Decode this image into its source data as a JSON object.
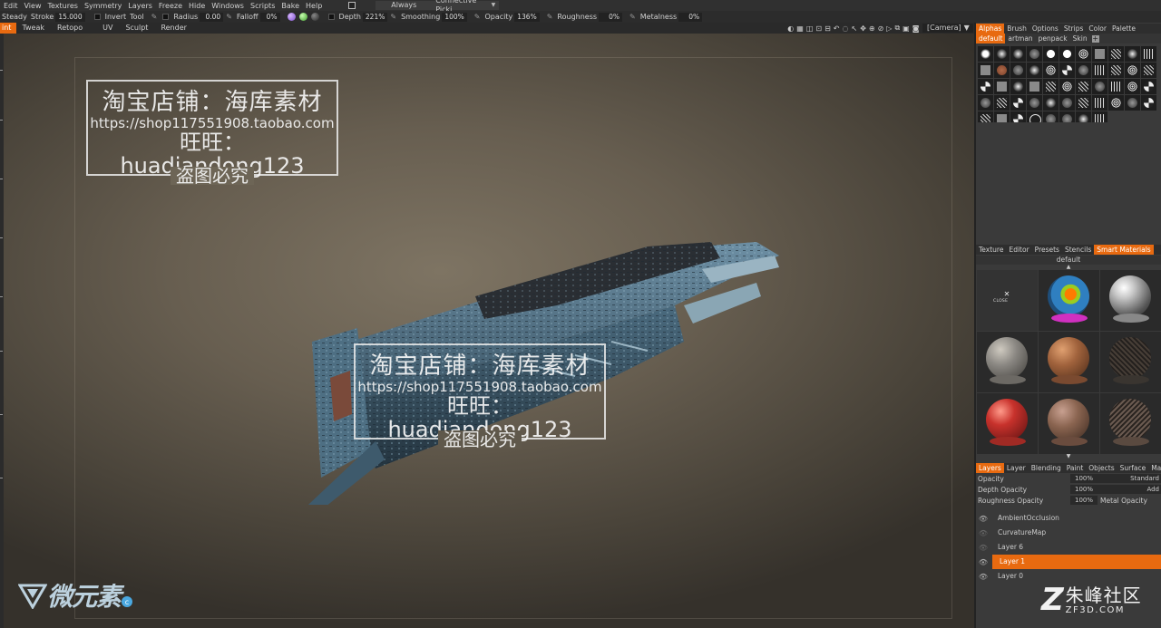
{
  "menubar": {
    "items": [
      "Edit",
      "View",
      "Textures",
      "Symmetry",
      "Layers",
      "Freeze",
      "Hide",
      "Windows",
      "Scripts",
      "Bake",
      "Help"
    ],
    "mode_select": "Always",
    "connective_select": "Connective Picki"
  },
  "toolbar": {
    "steady_label": "Steady",
    "stroke_label": "Stroke",
    "stroke_value": "15.000",
    "invert_label": "Invert",
    "tool_label": "Tool",
    "radius_label": "Radius",
    "radius_value": "0.00",
    "falloff_label": "Falloff",
    "falloff_value": "0%",
    "depth_label": "Depth",
    "depth_value": "221%",
    "smoothing_label": "Smoothing",
    "smoothing_value": "100%",
    "opacity_label": "Opacity",
    "opacity_value": "136%",
    "roughness_label": "Roughness",
    "roughness_value": "0%",
    "metalness_label": "Metalness",
    "metalness_value": "0%"
  },
  "rooms": [
    "int",
    "Tweak",
    "Retopo",
    "UV",
    "Sculpt",
    "Render"
  ],
  "camera_select": "[Camera]",
  "viewport": {
    "watermark": {
      "line1": "淘宝店铺：海库素材",
      "line2": "https://shop117551908.taobao.com",
      "line3": "旺旺：huadiandong123",
      "line4": "盗图必究"
    },
    "logo_left": "微元素"
  },
  "alphas_panel": {
    "tabs": [
      "Alphas",
      "Brush",
      "Options",
      "Strips",
      "Color",
      "Palette"
    ],
    "subtabs": [
      "default",
      "artman",
      "penpack",
      "Skin"
    ],
    "add_button": "+"
  },
  "smart_panel": {
    "tabs": [
      "Texture",
      "Editor",
      "Presets",
      "Stencils",
      "Smart Materials"
    ],
    "folder": "default",
    "close_label": "CLOSE",
    "scroll_up": "▲",
    "scroll_down": "▼",
    "materials": [
      {
        "id": "close"
      },
      {
        "id": "material-color-ball",
        "color": "#2f7fc0"
      },
      {
        "id": "material-chrome",
        "color": "#b8b8b8"
      },
      {
        "id": "material-iron",
        "color": "#8a8782"
      },
      {
        "id": "material-copper",
        "color": "#a0623c"
      },
      {
        "id": "material-wire-dark",
        "color": "#3a3530"
      },
      {
        "id": "material-red-paint",
        "color": "#c8322c"
      },
      {
        "id": "material-rust",
        "color": "#8a6450"
      },
      {
        "id": "material-wire-brown",
        "color": "#5a4a40"
      }
    ]
  },
  "layers_panel": {
    "tabs": [
      "Layers",
      "Layer",
      "Blending",
      "Paint",
      "Objects",
      "Surface",
      "Materials"
    ],
    "opacity_label": "Opacity",
    "opacity_value": "100%",
    "opacity_mode": "Standard",
    "depth_opacity_label": "Depth Opacity",
    "depth_opacity_value": "100%",
    "depth_mode": "Add",
    "roughness_opacity_label": "Roughness Opacity",
    "roughness_opacity_value": "100%",
    "metal_opacity_label": "Metal Opacity",
    "layers": [
      "AmbientOcclusion",
      "CurvatureMap",
      "Layer 6",
      "Layer 1",
      "Layer 0"
    ]
  },
  "logo_right": {
    "mark": "Z",
    "name": "朱峰社区",
    "url": "ZF3D.COM"
  },
  "colors": {
    "accent": "#e86a10"
  }
}
